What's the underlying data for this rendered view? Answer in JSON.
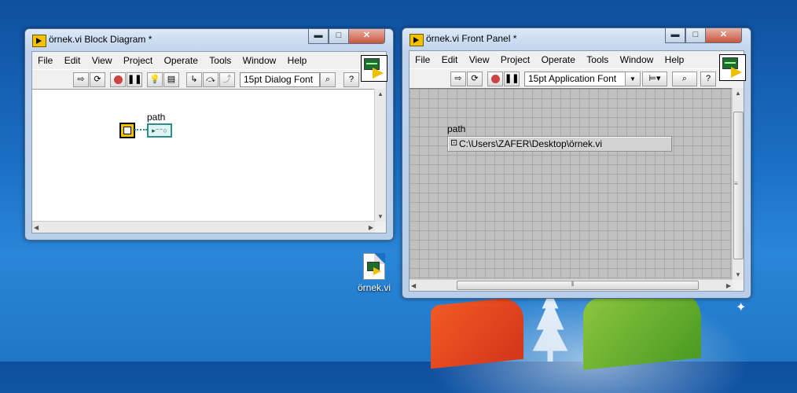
{
  "block_diagram": {
    "title": "örnek.vi Block Diagram *",
    "menu": [
      "File",
      "Edit",
      "View",
      "Project",
      "Operate",
      "Tools",
      "Window",
      "Help"
    ],
    "font_selector": "15pt Dialog Font",
    "terminal_label": "path"
  },
  "front_panel": {
    "title": "örnek.vi Front Panel *",
    "menu": [
      "File",
      "Edit",
      "View",
      "Project",
      "Operate",
      "Tools",
      "Window",
      "Help"
    ],
    "font_selector": "15pt Application Font",
    "control_label": "path",
    "path_value": "C:\\Users\\ZAFER\\Desktop\\örnek.vi"
  },
  "desktop": {
    "icon_label": "örnek.vi"
  },
  "window_buttons": {
    "minimize": "▬",
    "maximize": "□",
    "close": "✕"
  },
  "scroll_glyphs": {
    "up": "▲",
    "down": "▼",
    "left": "◀",
    "right": "▶",
    "grip_v": "≡",
    "grip_h": "⦀"
  },
  "colors": {
    "accent": "#f2c200",
    "desktop": "#1b6fc4"
  }
}
